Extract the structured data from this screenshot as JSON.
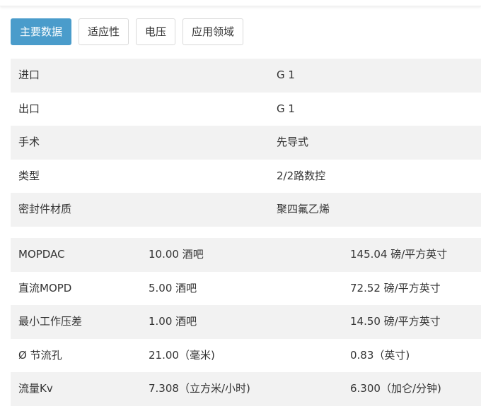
{
  "tabs": [
    {
      "label": "主要数据",
      "active": true
    },
    {
      "label": "适应性",
      "active": false
    },
    {
      "label": "电压",
      "active": false
    },
    {
      "label": "应用领域",
      "active": false
    }
  ],
  "main_data": {
    "properties": [
      {
        "label": "进口",
        "value": "G 1"
      },
      {
        "label": "出口",
        "value": "G 1"
      },
      {
        "label": "手术",
        "value": "先导式"
      },
      {
        "label": "类型",
        "value": "2/2路数控"
      },
      {
        "label": "密封件材质",
        "value": "聚四氟乙烯"
      }
    ],
    "specs": [
      {
        "label": "MOPDAC",
        "metric": "10.00 酒吧",
        "imperial": "145.04 磅/平方英寸"
      },
      {
        "label": "直流MOPD",
        "metric": "5.00 酒吧",
        "imperial": "72.52 磅/平方英寸"
      },
      {
        "label": "最小工作压差",
        "metric": "1.00 酒吧",
        "imperial": "14.50 磅/平方英寸"
      },
      {
        "label": "Ø 节流孔",
        "metric": "21.00（毫米)",
        "imperial": "0.83（英寸)"
      },
      {
        "label": "流量Kv",
        "metric": "7.308（立方米/小时)",
        "imperial": "6.300（加仑/分钟)"
      }
    ]
  },
  "colors": {
    "accent": "#4a9ccb",
    "row_stripe": "#f2f2f2",
    "text": "#333333"
  }
}
